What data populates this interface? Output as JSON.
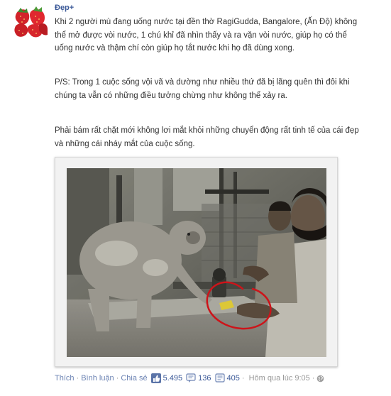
{
  "post": {
    "page_name": "Đẹp+",
    "paragraphs": [
      "Khi 2 người mù đang uống nước tại đền thờ RagiGudda, Bangalore, (Ấn Độ) không thể mở được vòi nước, 1 chú khỉ đã nhìn thấy và ra vặn vòi nước, giúp họ có thể uống nước và thậm chí còn giúp họ tắt nước khi họ đã dùng xong.",
      "P/S: Trong 1 cuộc sống vội vã và dường như nhiều thứ đã bị lãng quên thì đôi khi chúng ta vẫn có những điều tưởng chừng như không thể xảy ra.",
      "Phải bám rất chặt mới không lơi mắt khỏi những chuyển động rất tinh tế của cái đẹp và những cái nháy mắt của cuộc sống."
    ]
  },
  "actions": {
    "like_label": "Thích",
    "comment_label": "Bình luận",
    "share_label": "Chia sẻ",
    "separator": "·",
    "likes_count": "5.495",
    "comments_count": "136",
    "shares_count": "405",
    "timestamp": "Hôm qua lúc 9:05",
    "separator_end": "·"
  },
  "colors": {
    "link": "#6d84b4",
    "name": "#3b5998",
    "text": "#333333",
    "meta": "#999999"
  },
  "icons": {
    "avatar": "strawberry-avatar",
    "like": "thumbs-up-icon",
    "comment": "comment-bubble-icon",
    "share": "share-icon",
    "privacy": "globe-icon"
  }
}
